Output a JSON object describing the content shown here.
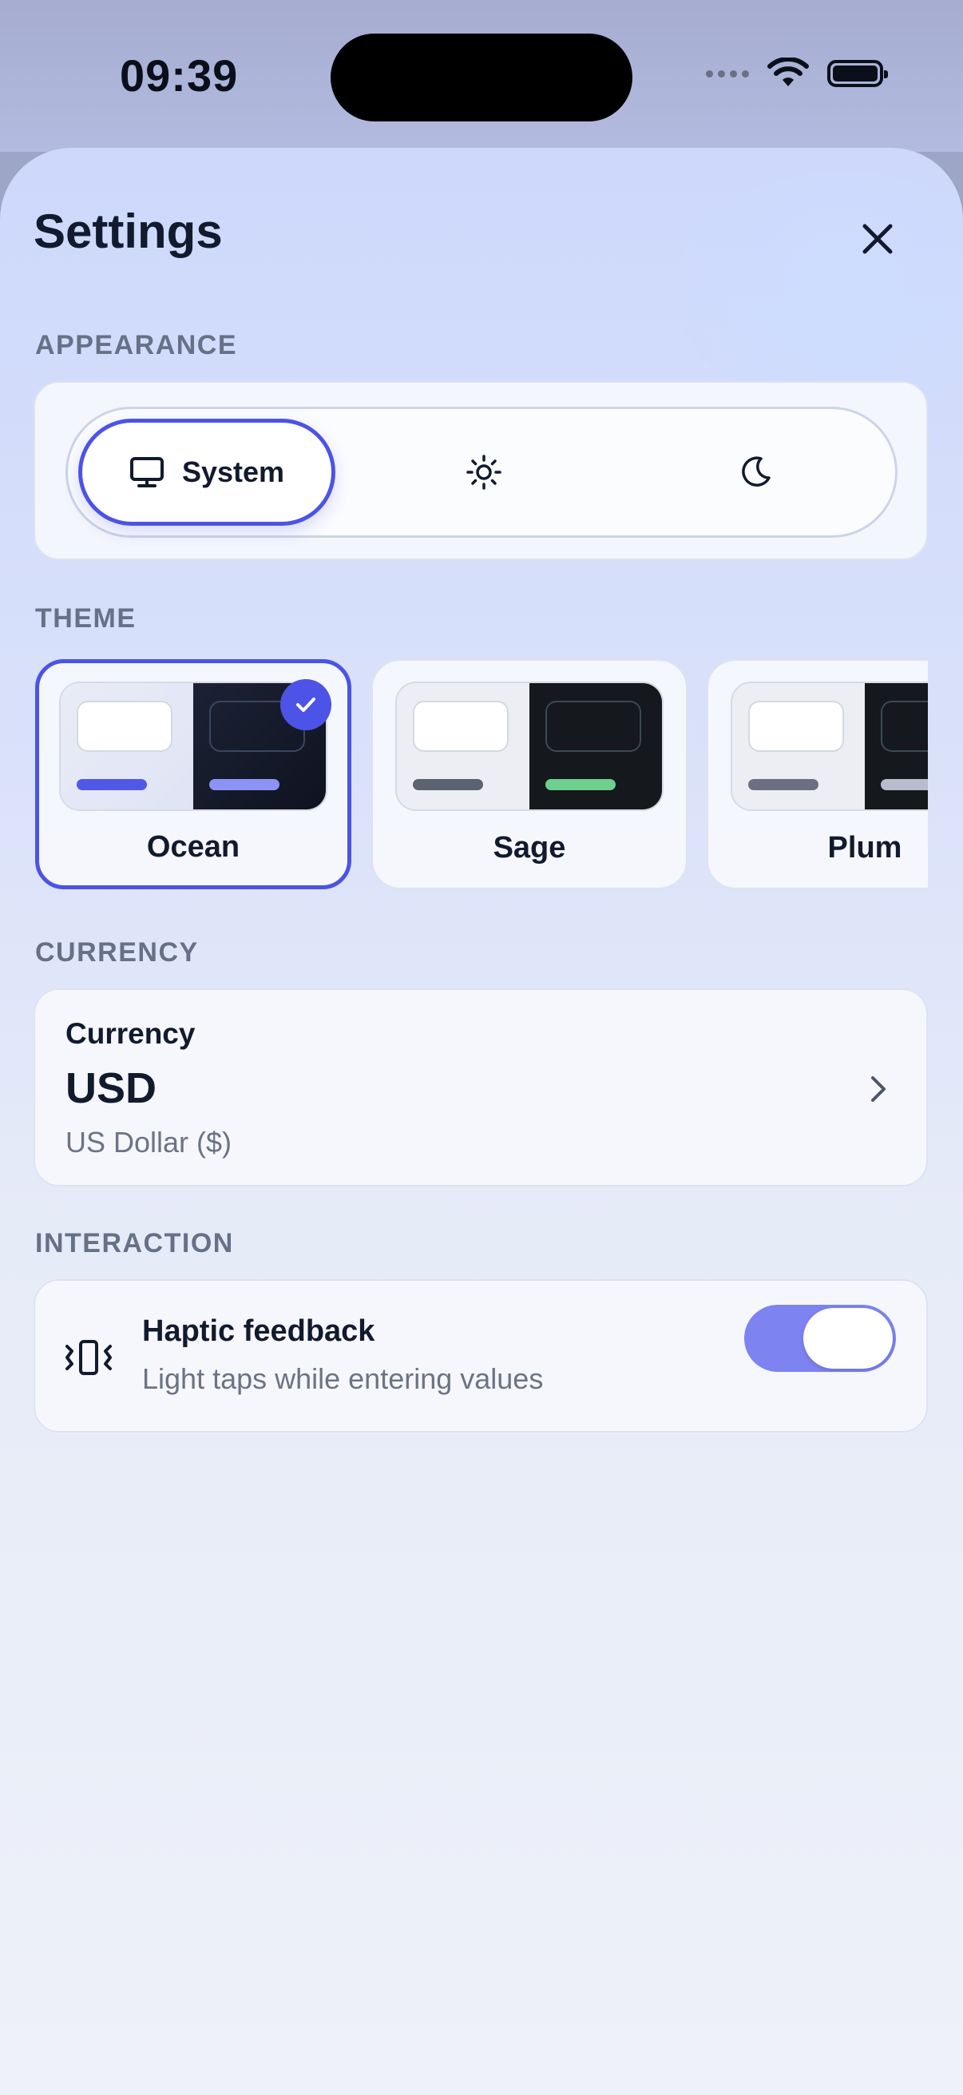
{
  "status": {
    "time": "09:39"
  },
  "header": {
    "title": "Settings"
  },
  "appearance": {
    "label": "APPEARANCE",
    "options": [
      {
        "label": "System",
        "icon": "monitor-icon",
        "selected": true
      },
      {
        "label": "",
        "icon": "sun-icon",
        "selected": false
      },
      {
        "label": "",
        "icon": "moon-icon",
        "selected": false
      }
    ]
  },
  "theme": {
    "label": "THEME",
    "items": [
      {
        "name": "Ocean",
        "selected": true,
        "accent_light": "#5058e8",
        "accent_dark": "#8d93f5"
      },
      {
        "name": "Sage",
        "selected": false,
        "accent_light": "#5b6270",
        "accent_dark": "#6fcf8f"
      },
      {
        "name": "Plum",
        "selected": false,
        "accent_light": "#6b7080",
        "accent_dark": "#b8bccc"
      }
    ]
  },
  "currency": {
    "label": "CURRENCY",
    "title": "Currency",
    "code": "USD",
    "name": "US Dollar ($)"
  },
  "interaction": {
    "label": "INTERACTION",
    "haptic_title": "Haptic feedback",
    "haptic_sub": "Light taps while entering values",
    "haptic_on": true
  },
  "colors": {
    "accent": "#4c53e6",
    "toggle_on": "#7d83f1",
    "text": "#121a2e",
    "muted": "#667087"
  }
}
